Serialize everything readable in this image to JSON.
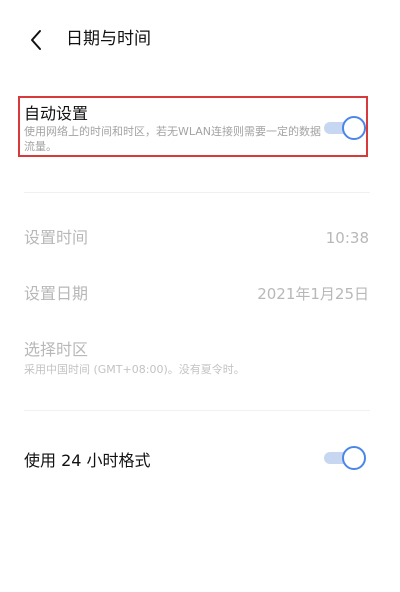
{
  "header": {
    "title": "日期与时间",
    "back_icon": "chevron-left-icon"
  },
  "auto_setting": {
    "title": "自动设置",
    "description": "使用网络上的时间和时区，若无WLAN连接则需要一定的数据流量。",
    "enabled": true,
    "highlight_color": "#d63a3a"
  },
  "set_time": {
    "label": "设置时间",
    "value": "10:38"
  },
  "set_date": {
    "label": "设置日期",
    "value": "2021年1月25日"
  },
  "timezone": {
    "label": "选择时区",
    "description": "采用中国时间 (GMT+08:00)。没有夏令时。"
  },
  "format_24h": {
    "label": "使用 24 小时格式",
    "enabled": true
  },
  "colors": {
    "accent": "#4a86e8",
    "track": "#c7d7f2",
    "disabled_text": "#b8b8b8"
  }
}
